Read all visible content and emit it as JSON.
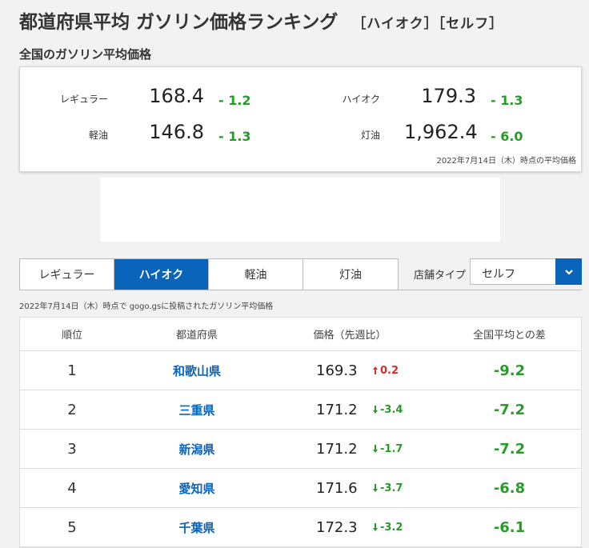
{
  "page_title": "都道府県平均 ガソリン価格ランキング",
  "title_suffix": "［ハイオク］［セルフ］",
  "section_label": "全国のガソリン平均価格",
  "summary": {
    "items": [
      {
        "label": "レギュラー",
        "value": "168.4",
        "change": "- 1.2"
      },
      {
        "label": "ハイオク",
        "value": "179.3",
        "change": "- 1.3"
      },
      {
        "label": "軽油",
        "value": "146.8",
        "change": "- 1.3"
      },
      {
        "label": "灯油",
        "value": "1,962.4",
        "change": "- 6.0"
      }
    ],
    "date_note": "2022年7月14日（木）時点の平均価格"
  },
  "fuel_tabs": [
    {
      "label": "レギュラー",
      "active": false
    },
    {
      "label": "ハイオク",
      "active": true
    },
    {
      "label": "軽油",
      "active": false
    },
    {
      "label": "灯油",
      "active": false
    }
  ],
  "store_type": {
    "label": "店舗タイプ",
    "selected": "セルフ"
  },
  "note": "2022年7月14日（木）時点で gogo.gsに投稿されたガソリン平均価格",
  "table": {
    "headers": [
      "順位",
      "都道府県",
      "価格（先週比）",
      "全国平均との差"
    ],
    "rows": [
      {
        "rank": "1",
        "prefecture": "和歌山県",
        "price": "169.3",
        "change": "0.2",
        "direction": "up",
        "diff": "-9.2"
      },
      {
        "rank": "2",
        "prefecture": "三重県",
        "price": "171.2",
        "change": "-3.4",
        "direction": "down",
        "diff": "-7.2"
      },
      {
        "rank": "3",
        "prefecture": "新潟県",
        "price": "171.2",
        "change": "-1.7",
        "direction": "down",
        "diff": "-7.2"
      },
      {
        "rank": "4",
        "prefecture": "愛知県",
        "price": "171.6",
        "change": "-3.7",
        "direction": "down",
        "diff": "-6.8"
      },
      {
        "rank": "5",
        "prefecture": "千葉県",
        "price": "172.3",
        "change": "-3.2",
        "direction": "down",
        "diff": "-6.1"
      }
    ]
  },
  "colors": {
    "accent": "#0a64b9",
    "down": "#2a9a2a",
    "up": "#d62d2d"
  }
}
